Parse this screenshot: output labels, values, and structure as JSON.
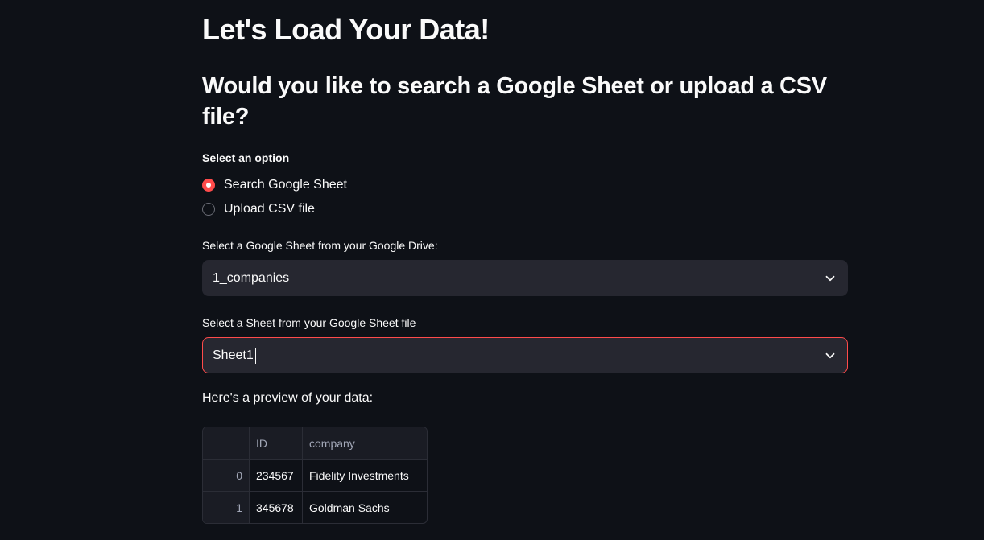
{
  "page": {
    "title": "Let's Load Your Data!",
    "subtitle": "Would you like to search a Google Sheet or upload a CSV file?"
  },
  "source_option": {
    "label": "Select an option",
    "options": [
      "Search Google Sheet",
      "Upload CSV file"
    ],
    "selected": "Search Google Sheet"
  },
  "sheet_file_select": {
    "label": "Select a Google Sheet from your Google Drive:",
    "value": "1_companies"
  },
  "sheet_tab_select": {
    "label": "Select a Sheet from your Google Sheet file",
    "value": "Sheet1"
  },
  "preview": {
    "text": "Here's a preview of your data:",
    "columns": [
      "",
      "ID",
      "company"
    ],
    "rows": [
      [
        "0",
        "234567",
        "Fidelity Investments"
      ],
      [
        "1",
        "345678",
        "Goldman Sachs"
      ]
    ]
  },
  "colors": {
    "background": "#0e1117",
    "accent": "#ff4b4b",
    "widget_bg": "#262730"
  },
  "icons": {
    "dropdown": "chevron-down-icon"
  }
}
